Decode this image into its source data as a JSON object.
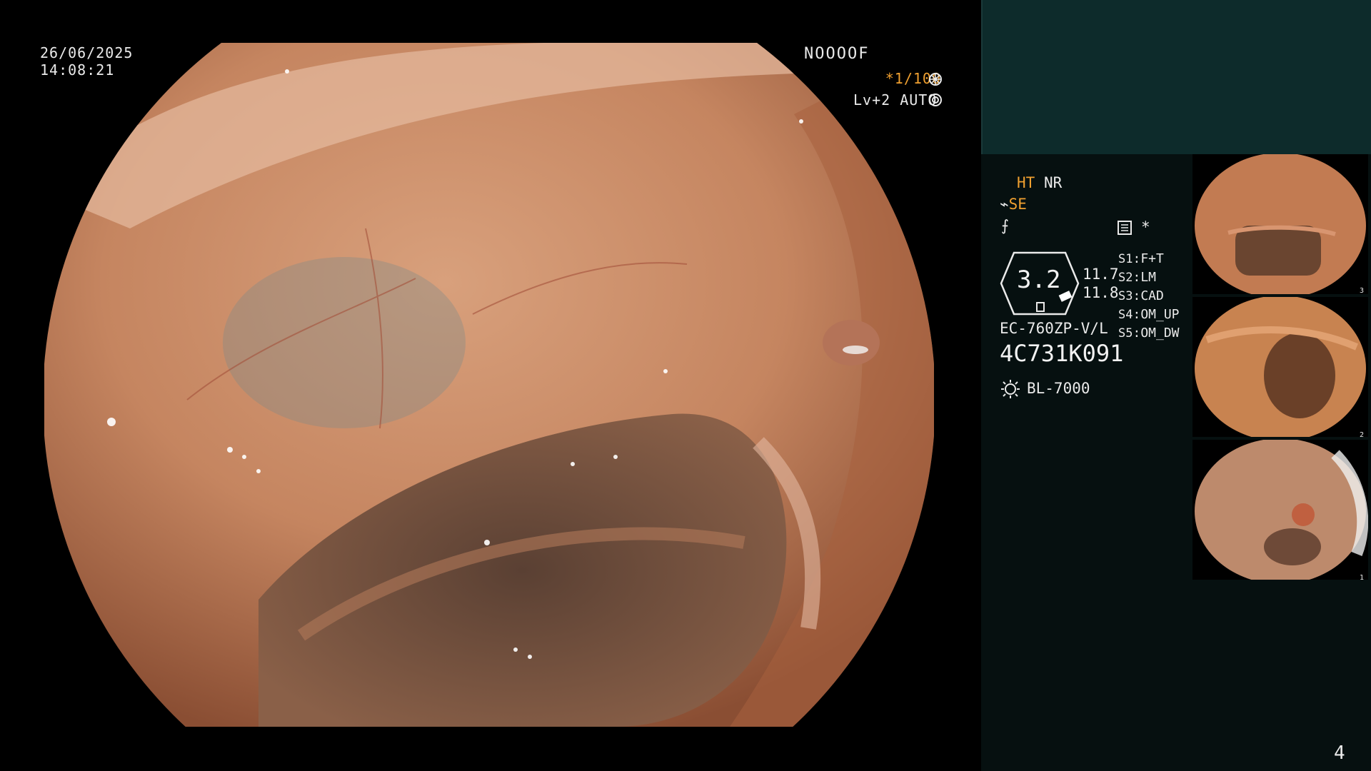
{
  "osd": {
    "date": "26/06/2025",
    "time": "14:08:21",
    "id_code": "NOOOOF",
    "shutter": "*1/100",
    "level_mode": "Lv+2 AUTO"
  },
  "panel": {
    "ht_label": "HT",
    "nr_label": "NR",
    "se_label": "SE",
    "gauge_value": "3.2",
    "depth_top": "11.7",
    "depth_bottom": "11.8",
    "scope_model": "EC-760ZP-V/L",
    "serial": "4C731K091",
    "light_source": "BL-7000",
    "s_settings": [
      {
        "key": "S1",
        "value": "F+T"
      },
      {
        "key": "S2",
        "value": "LM"
      },
      {
        "key": "S3",
        "value": "CAD"
      },
      {
        "key": "S4",
        "value": "OM_UP"
      },
      {
        "key": "S5",
        "value": "OM_DW"
      }
    ],
    "thumbnail_count": [
      "3",
      "2",
      "1"
    ],
    "page_number": "4"
  },
  "colors": {
    "accent_orange": "#f0a030",
    "panel_bg": "#061010",
    "panel_top_band": "#0d2b2b",
    "mucosa": "#c98562"
  },
  "icons": [
    "shutter-aperture-icon",
    "auto-iris-icon",
    "se-lightning-icon",
    "freeze-icon",
    "memory-card-icon",
    "light-bulb-icon"
  ]
}
